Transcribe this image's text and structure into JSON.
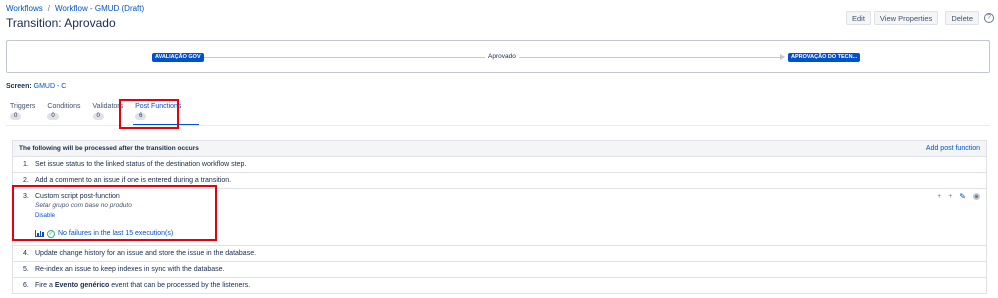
{
  "breadcrumb": {
    "items": [
      "Workflows",
      "Workflow - GMUD (Draft)"
    ],
    "separator": "/"
  },
  "page_title": "Transition: Aprovado",
  "actions": {
    "edit": "Edit",
    "view_properties": "View Properties",
    "delete": "Delete",
    "help": "?"
  },
  "diagram": {
    "from_status": "AVALIAÇÃO GOV",
    "transition": "Aprovado",
    "to_status": "APROVAÇÃO DO TECN..."
  },
  "screen": {
    "label": "Screen:",
    "value": "GMUD - C"
  },
  "tabs": [
    {
      "label": "Triggers",
      "count": "0"
    },
    {
      "label": "Conditions",
      "count": "0"
    },
    {
      "label": "Validators",
      "count": "0"
    },
    {
      "label": "Post Functions",
      "count": "6"
    }
  ],
  "post_functions": {
    "header": "The following will be processed after the transition occurs",
    "add_link": "Add post function",
    "rows": [
      {
        "num": "1.",
        "text": "Set issue status to the linked status of the destination workflow step."
      },
      {
        "num": "2.",
        "text": "Add a comment to an issue if one is entered during a transition."
      },
      {
        "num": "3.",
        "text": "Custom script post-function",
        "description": "Setar grupo com base no produto",
        "disable": "Disable",
        "status": "No failures in the last 15 execution(s)"
      },
      {
        "num": "4.",
        "text": "Update change history for an issue and store the issue in the database."
      },
      {
        "num": "5.",
        "text": "Re-index an issue to keep indexes in sync with the database."
      },
      {
        "num": "6.",
        "text_before": "Fire a",
        "event": "Evento genérico",
        "text_after": "event that can be processed by the listeners."
      }
    ],
    "row_actions": {
      "move_up": "+",
      "move_down": "+"
    }
  },
  "colors": {
    "accent": "#0052cc",
    "highlight": "#e3000f",
    "success": "#36b37e"
  }
}
